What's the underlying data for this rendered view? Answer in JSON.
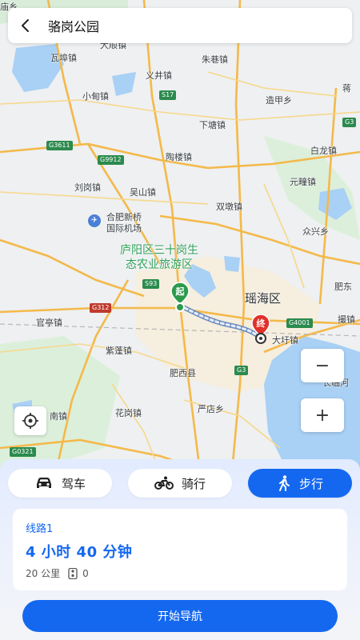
{
  "header": {
    "title": "骆岗公园",
    "back_icon": "back-arrow-icon"
  },
  "map": {
    "places": [
      "朱巷镇",
      "义井镇",
      "瓦埠镇",
      "小甸镇",
      "造甲乡",
      "蒋",
      "下塘镇",
      "白龙镇",
      "陶楼镇",
      "元疃镇",
      "刘岗镇",
      "吴山镇",
      "双墩镇",
      "合肥新桥",
      "国际机场",
      "众兴乡",
      "庐阳区三十岗生",
      "态农业旅游区",
      "肥东",
      "瑶海区",
      "撮镇",
      "官亭镇",
      "大圩镇",
      "紫蓬镇",
      "长临河",
      "肥西县",
      "花岗镇",
      "严店乡",
      "南镇",
      "大顺镇",
      "庙乡"
    ],
    "roads": [
      "S17",
      "G3",
      "G3611",
      "G9912",
      "S93",
      "G312",
      "G4001",
      "G0321",
      "G3"
    ],
    "start_marker": "起",
    "end_marker": "终"
  },
  "controls": {
    "zoom_out": "−",
    "zoom_in": "+"
  },
  "modes": [
    {
      "label": "驾车",
      "icon": "car-icon",
      "active": false
    },
    {
      "label": "骑行",
      "icon": "bike-icon",
      "active": false
    },
    {
      "label": "步行",
      "icon": "walk-icon",
      "active": true
    }
  ],
  "route": {
    "name": "线路1",
    "duration": "4 小时 40 分钟",
    "distance": "20 公里",
    "traffic_lights": "0"
  },
  "actions": {
    "start_nav": "开始导航"
  },
  "colors": {
    "accent": "#1468f0",
    "start": "#2c9a4a",
    "end": "#e0322b"
  }
}
